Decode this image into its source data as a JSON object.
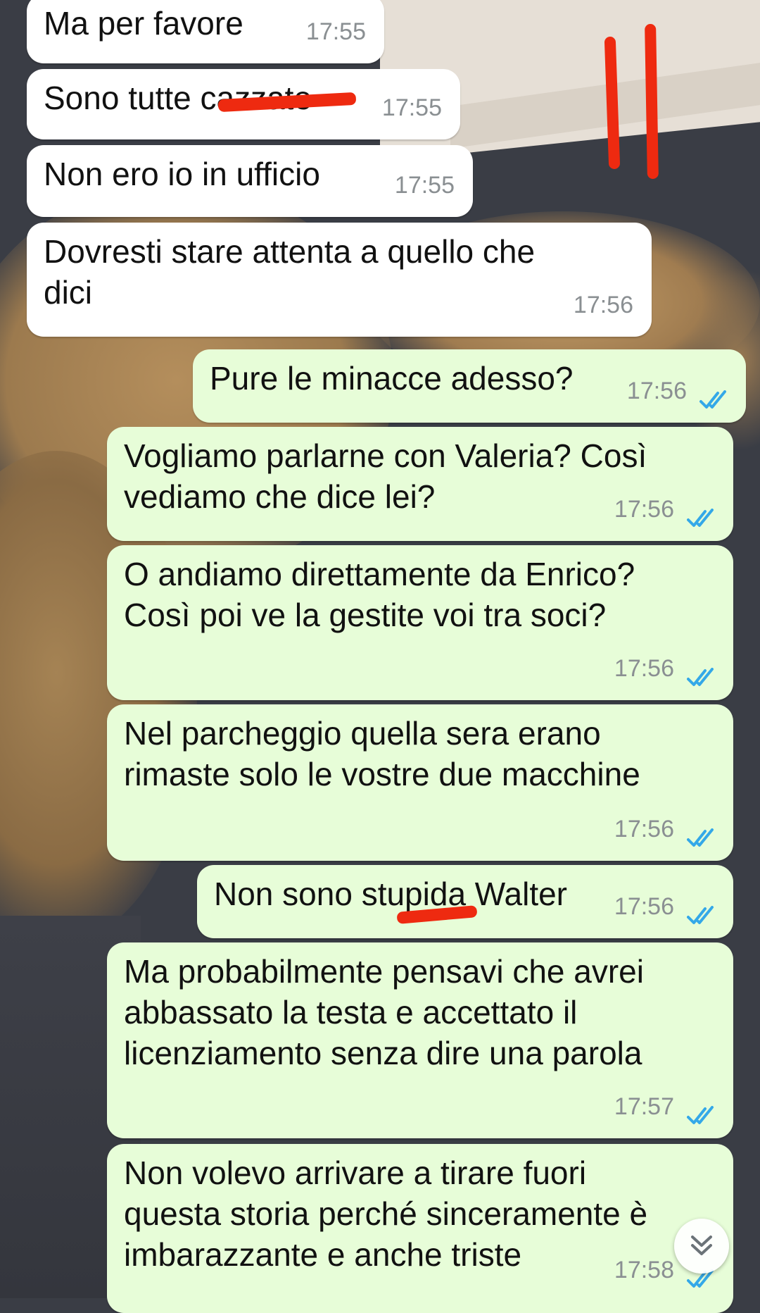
{
  "wallpaper": {
    "description_colors": {
      "floor": "#3a3d45",
      "cat_fur": "#a8865a",
      "wall": "#e8e2da"
    }
  },
  "messages": [
    {
      "dir": "in",
      "text": "Ma per favore",
      "time": "17:55"
    },
    {
      "dir": "in",
      "text": "Sono tutte cazzate",
      "time": "17:55"
    },
    {
      "dir": "in",
      "text": "Non ero io in ufficio",
      "time": "17:55"
    },
    {
      "dir": "in",
      "text": "Dovresti stare attenta a quello che\ndici",
      "time": "17:56"
    },
    {
      "dir": "out",
      "text": "Pure le minacce adesso?",
      "time": "17:56",
      "status": "read"
    },
    {
      "dir": "out",
      "text": "Vogliamo parlarne con Valeria? Così\nvediamo che dice lei?",
      "time": "17:56",
      "status": "read"
    },
    {
      "dir": "out",
      "text": "O andiamo direttamente da Enrico?\nCosì poi ve la gestite voi tra soci?",
      "time": "17:56",
      "status": "read"
    },
    {
      "dir": "out",
      "text": "Nel parcheggio quella sera erano\nrimaste solo le vostre due macchine",
      "time": "17:56",
      "status": "read"
    },
    {
      "dir": "out",
      "text": "Non sono stupida Walter",
      "time": "17:56",
      "status": "read"
    },
    {
      "dir": "out",
      "text": "Ma probabilmente pensavi che avrei\nabbassato la testa e accettato il\nlicenziamento senza dire una parola",
      "time": "17:57",
      "status": "read"
    },
    {
      "dir": "out",
      "text": "Non volevo arrivare a tirare fuori\nquesta storia perché sinceramente è\nimbarazzante e anche triste",
      "time": "17:58",
      "status": "read"
    }
  ],
  "colors": {
    "incoming_bubble": "#ffffff",
    "outgoing_bubble": "#e7fdd8",
    "read_ticks": "#34a8e8",
    "redaction": "#ee2a10"
  },
  "icons": {
    "scroll_down": "double-chevron-down-icon",
    "read_receipt": "double-check-icon"
  }
}
